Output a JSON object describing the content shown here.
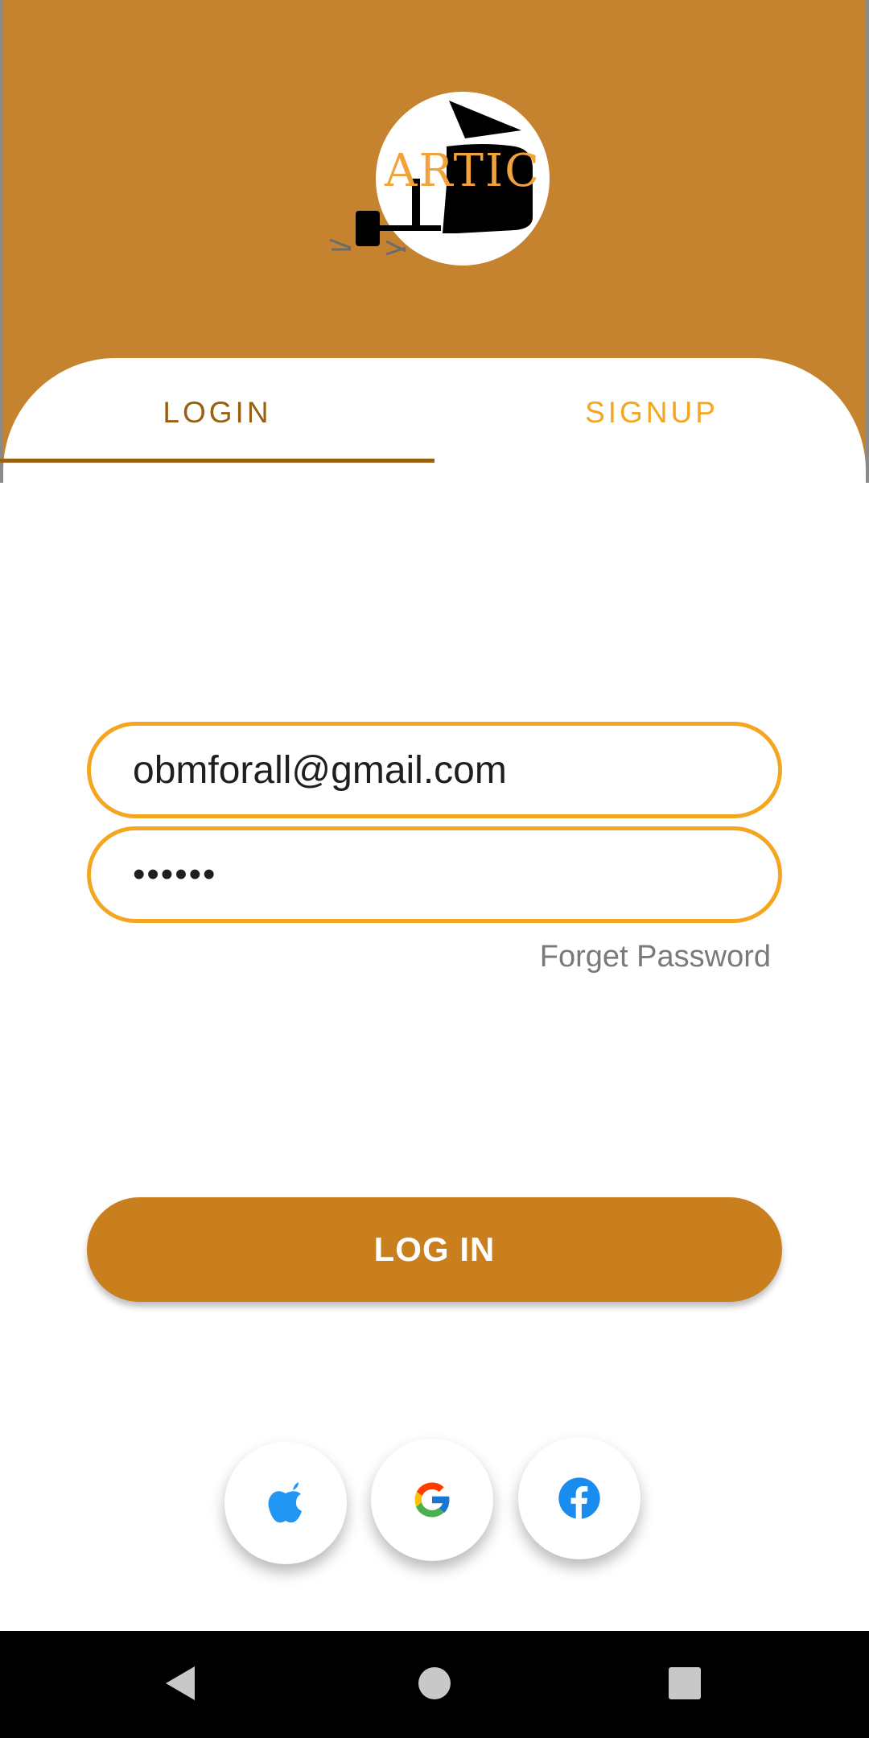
{
  "app": {
    "logo_text": "ARTIC"
  },
  "tabs": {
    "login_label": "LOGIN",
    "signup_label": "SIGNUP",
    "active": "LOGIN"
  },
  "form": {
    "email_value": "obmforall@gmail.com",
    "password_value": "••••••",
    "forget_password_label": "Forget Password",
    "login_button_label": "LOG IN"
  },
  "social": {
    "buttons": [
      "apple-icon",
      "google-icon",
      "facebook-icon"
    ]
  },
  "nav": {
    "buttons": [
      "back-icon",
      "home-icon",
      "recents-icon"
    ]
  },
  "colors": {
    "brand": "#C58330",
    "button": "#C97F1E",
    "accent": "#F5A621",
    "tab_active": "#9A6012"
  }
}
